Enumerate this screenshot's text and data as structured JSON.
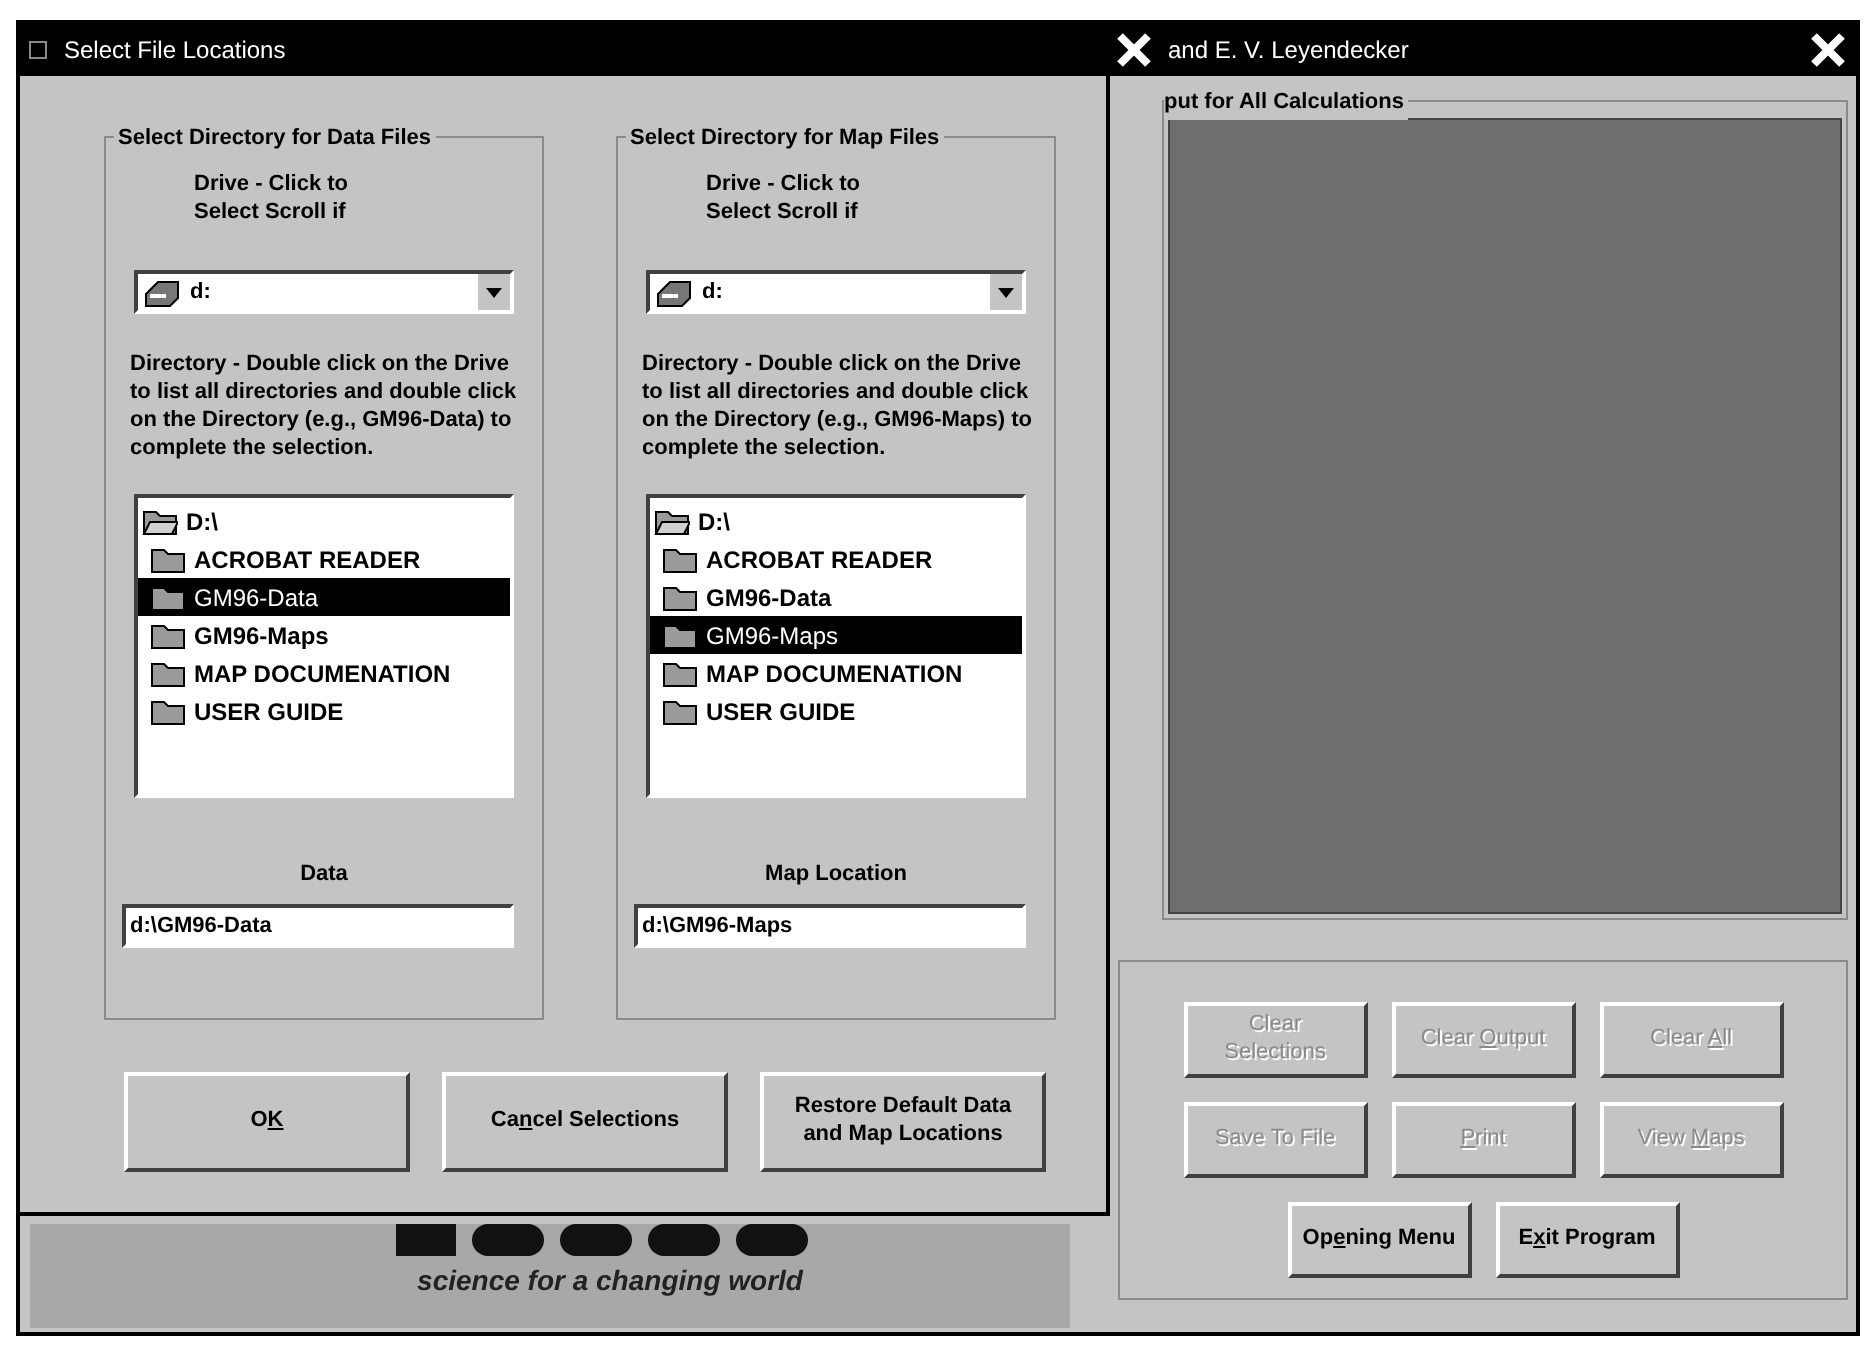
{
  "main_window": {
    "title": "and E. V. Leyendecker",
    "output_group": {
      "label": "put for All Calculations"
    },
    "button_rows": [
      [
        {
          "before": "Clear Selections",
          "disabled": true
        },
        {
          "before": "Clear ",
          "key": "O",
          "after": "utput",
          "disabled": true
        },
        {
          "before": "Clear ",
          "key": "A",
          "after": "ll",
          "disabled": true
        }
      ],
      [
        {
          "before": "Save To File",
          "disabled": true
        },
        {
          "key": "P",
          "after": "rint",
          "disabled": true
        },
        {
          "before": "View ",
          "key": "M",
          "after": "aps",
          "disabled": true
        }
      ],
      [
        {
          "before": "Op",
          "key": "e",
          "after": "ning Menu",
          "disabled": false
        },
        {
          "before": "E",
          "key": "x",
          "after": "it Program",
          "disabled": false
        }
      ]
    ],
    "logo": {
      "tagline": "science for a changing world"
    }
  },
  "dialog": {
    "title": "Select File Locations",
    "groups": [
      {
        "title": "Select Directory for Data Files",
        "drive_label": "Drive - Click to Select Scroll if",
        "drive": "d:",
        "description": "Directory - Double click on the Drive to list all directories and double click on the Directory (e.g., GM96-Data) to complete the selection.",
        "tree": {
          "name": "D:\\",
          "selected": false,
          "children": [
            {
              "name": "ACROBAT READER",
              "selected": false
            },
            {
              "name": "GM96-Data",
              "selected": true
            },
            {
              "name": "GM96-Maps",
              "selected": false
            },
            {
              "name": "MAP DOCUMENATION",
              "selected": false
            },
            {
              "name": "USER GUIDE",
              "selected": false
            }
          ]
        },
        "path_label": "Data",
        "path_value": "d:\\GM96-Data"
      },
      {
        "title": "Select Directory for Map Files",
        "drive_label": "Drive - Click to Select Scroll if",
        "drive": "d:",
        "description": "Directory - Double click on the Drive to list all directories and double click on the Directory (e.g., GM96-Maps) to complete the selection.",
        "tree": {
          "name": "D:\\",
          "selected": false,
          "children": [
            {
              "name": "ACROBAT READER",
              "selected": false
            },
            {
              "name": "GM96-Data",
              "selected": false
            },
            {
              "name": "GM96-Maps",
              "selected": true
            },
            {
              "name": "MAP DOCUMENATION",
              "selected": false
            },
            {
              "name": "USER GUIDE",
              "selected": false
            }
          ]
        },
        "path_label": "Map Location",
        "path_value": "d:\\GM96-Maps"
      }
    ],
    "buttons": [
      {
        "before": "O",
        "key": "K",
        "disabled": false
      },
      {
        "before": "Ca",
        "key": "n",
        "after": "cel Selections",
        "disabled": false
      },
      {
        "before": "Restore Default Data and Map Locations",
        "disabled": false
      }
    ]
  }
}
